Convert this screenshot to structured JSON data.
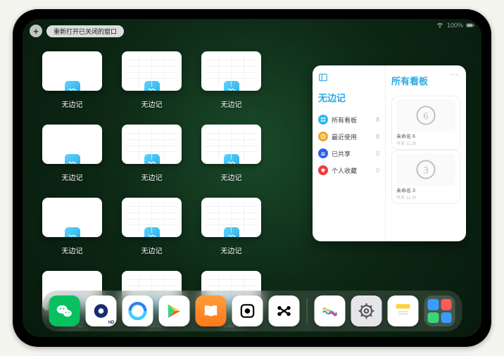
{
  "status": {
    "wifi": "wifi-icon",
    "battery_pct": "100%"
  },
  "toolbar": {
    "plus": "+",
    "reopen_label": "重新打开已关闭的窗口"
  },
  "app_name": "无边记",
  "thumbnails": [
    {
      "label": "无边记",
      "variant": "blank"
    },
    {
      "label": "无边记",
      "variant": "cal"
    },
    {
      "label": "无边记",
      "variant": "cal"
    },
    {
      "label": "无边记",
      "variant": "blank"
    },
    {
      "label": "无边记",
      "variant": "cal"
    },
    {
      "label": "无边记",
      "variant": "cal"
    },
    {
      "label": "无边记",
      "variant": "blank"
    },
    {
      "label": "无边记",
      "variant": "cal"
    },
    {
      "label": "无边记",
      "variant": "cal"
    },
    {
      "label": "无边记",
      "variant": "blank"
    },
    {
      "label": "无边记",
      "variant": "cal"
    },
    {
      "label": "无边记",
      "variant": "cal"
    }
  ],
  "panel": {
    "left_title": "无边记",
    "right_title": "所有看板",
    "items": [
      {
        "icon": "grid",
        "color": "#2bb6f0",
        "label": "所有看板",
        "count": 8
      },
      {
        "icon": "clock",
        "color": "#f0a72b",
        "label": "最近使用",
        "count": 8
      },
      {
        "icon": "share",
        "color": "#2b62f0",
        "label": "已共享",
        "count": 0
      },
      {
        "icon": "heart",
        "color": "#f03a3a",
        "label": "个人收藏",
        "count": 0
      }
    ],
    "boards": [
      {
        "sketch": "6",
        "title": "未命名 6",
        "time": "今天 11:20"
      },
      {
        "sketch": "3",
        "title": "未命名 3",
        "time": "今天 11:20"
      }
    ]
  },
  "dock": {
    "apps": [
      {
        "name": "wechat",
        "bg": "#07c160"
      },
      {
        "name": "quark",
        "bg": "#ffffff"
      },
      {
        "name": "qqbrowser",
        "bg": "#ffffff"
      },
      {
        "name": "play",
        "bg": "#ffffff"
      },
      {
        "name": "books",
        "bg": "linear-gradient(#ff9b3a,#ff7a1a)"
      },
      {
        "name": "dice",
        "bg": "#ffffff"
      },
      {
        "name": "dots",
        "bg": "#ffffff"
      }
    ],
    "recent": [
      {
        "name": "freeform",
        "bg": "#ffffff"
      },
      {
        "name": "settings",
        "bg": "#e5e5ea"
      },
      {
        "name": "notes",
        "bg": "#ffffff"
      }
    ],
    "folder": {
      "minis": [
        "#3a9cff",
        "#ff5a5a",
        "#3ad47a",
        "#3a9cff"
      ]
    }
  }
}
